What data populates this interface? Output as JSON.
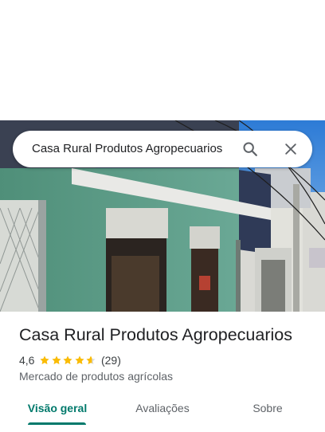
{
  "search": {
    "query": "Casa Rural Produtos Agropecuarios",
    "search_icon": "search-icon",
    "close_icon": "close-icon"
  },
  "place": {
    "name": "Casa Rural Produtos Agropecuarios",
    "rating": "4,6",
    "rating_value": 4.6,
    "review_count": "(29)",
    "category": "Mercado de produtos agrícolas",
    "star_color": "#fbbc04"
  },
  "tabs": [
    {
      "label": "Visão geral",
      "active": true
    },
    {
      "label": "Avaliações",
      "active": false
    },
    {
      "label": "Sobre",
      "active": false
    }
  ],
  "colors": {
    "accent": "#00796b",
    "storefront": "#5f9c86"
  }
}
